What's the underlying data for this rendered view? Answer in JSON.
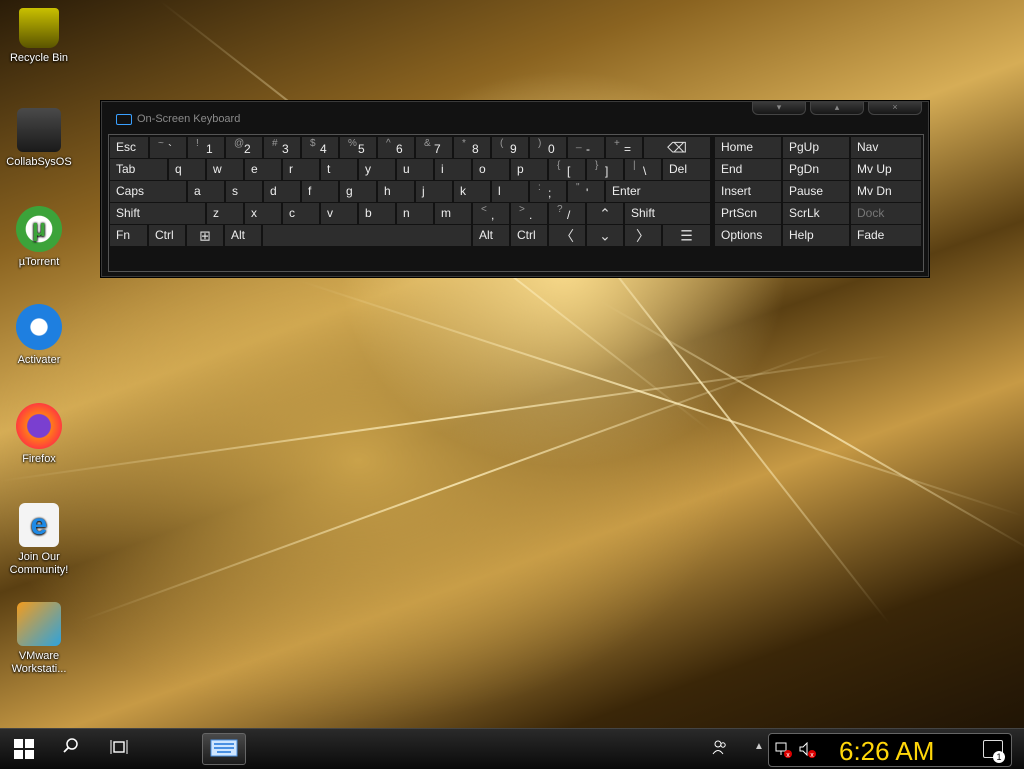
{
  "desktop": {
    "icons": [
      {
        "label": "Recycle Bin"
      },
      {
        "label": "CollabSysOS"
      },
      {
        "label": "µTorrent"
      },
      {
        "label": "Activater"
      },
      {
        "label": "Firefox"
      },
      {
        "label": "Join Our Community!"
      },
      {
        "label": "VMware Workstati..."
      }
    ]
  },
  "osk": {
    "title": "On-Screen Keyboard",
    "rows": {
      "row1": [
        "Esc",
        "~ `",
        "! 1",
        "@ 2",
        "# 3",
        "$ 4",
        "% 5",
        "^ 6",
        "& 7",
        "* 8",
        "( 9",
        ") 0",
        "_ -",
        "+ ="
      ],
      "row2": [
        "Tab",
        "q",
        "w",
        "e",
        "r",
        "t",
        "y",
        "u",
        "i",
        "o",
        "p",
        "{ [",
        "} ]",
        "| \\",
        "Del"
      ],
      "row3": [
        "Caps",
        "a",
        "s",
        "d",
        "f",
        "g",
        "h",
        "j",
        "k",
        "l",
        ": ;",
        "\" '",
        "Enter"
      ],
      "row4": [
        "Shift",
        "z",
        "x",
        "c",
        "v",
        "b",
        "n",
        "m",
        "< ,",
        "> .",
        "? /",
        "Shift"
      ],
      "row5": [
        "Fn",
        "Ctrl",
        "Alt",
        "Alt",
        "Ctrl"
      ]
    },
    "nav": [
      "Home",
      "PgUp",
      "Nav",
      "End",
      "PgDn",
      "Mv Up",
      "Insert",
      "Pause",
      "Mv Dn",
      "PrtScn",
      "ScrLk",
      "Dock",
      "Options",
      "Help",
      "Fade"
    ]
  },
  "taskbar": {
    "clock": "6:26 AM",
    "notification_count": "1"
  },
  "colors": {
    "clock": "#ffd60a",
    "key_bg": "#2d2d2d",
    "window_bg": "#121212"
  }
}
